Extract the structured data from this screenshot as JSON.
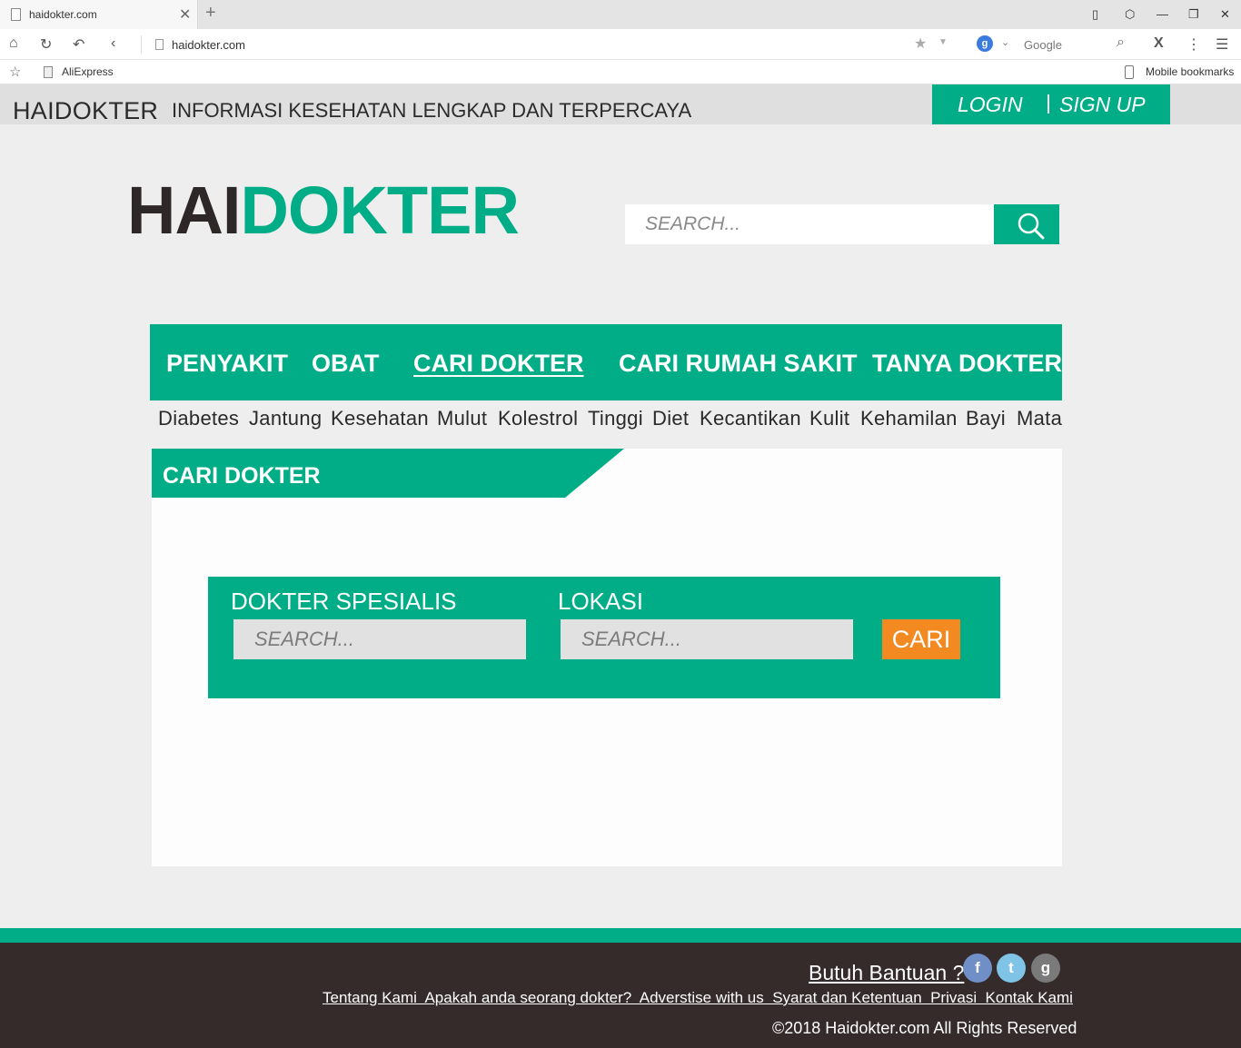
{
  "browser": {
    "tab_title": "haidokter.com",
    "url": "haidokter.com",
    "search_engine_placeholder": "Google",
    "bookmark_item": "AliExpress",
    "mobile_bookmarks": "Mobile bookmarks"
  },
  "topstrip": {
    "brand": "HAIDOKTER",
    "tagline": "INFORMASI KESEHATAN LENGKAP DAN TERPERCAYA",
    "login": "LOGIN",
    "signup": "SIGN UP"
  },
  "hero": {
    "logo_part1": "HAI",
    "logo_part2": "DOKTER",
    "search_placeholder": "SEARCH..."
  },
  "menu": {
    "items": [
      "PENYAKIT",
      "OBAT",
      "CARI DOKTER",
      "CARI RUMAH SAKIT",
      "TANYA DOKTER"
    ],
    "active": "CARI DOKTER"
  },
  "tags": [
    "Diabetes",
    "Jantung",
    "Kesehatan",
    "Mulut",
    "Kolestrol",
    "Tinggi",
    "Diet",
    "Kecantikan",
    "Kulit",
    "Kehamilan",
    "Bayi",
    "Mata"
  ],
  "card": {
    "title": "CARI DOKTER",
    "specialist_label": "DOKTER SPESIALIS",
    "specialist_placeholder": "SEARCH...",
    "location_label": "LOKASI",
    "location_placeholder": "SEARCH...",
    "submit": "CARI"
  },
  "footer": {
    "help": "Butuh Bantuan ?",
    "links": "Tentang Kami  Apakah anda seorang dokter?  Adverstise with us  Syarat dan Ketentuan  Privasi  Kontak Kami",
    "copyright": "2018 Haidokter.com All Rights Reserved",
    "social": [
      {
        "name": "facebook-icon",
        "glyph": "f",
        "color": "#6f8fc6"
      },
      {
        "name": "twitter-icon",
        "glyph": "t",
        "color": "#7fc4e6"
      },
      {
        "name": "google-icon",
        "glyph": "g",
        "color": "#7a7a7a"
      }
    ]
  },
  "colors": {
    "accent": "#00ad87",
    "dark": "#342b2a",
    "button_orange": "#f28a21"
  }
}
